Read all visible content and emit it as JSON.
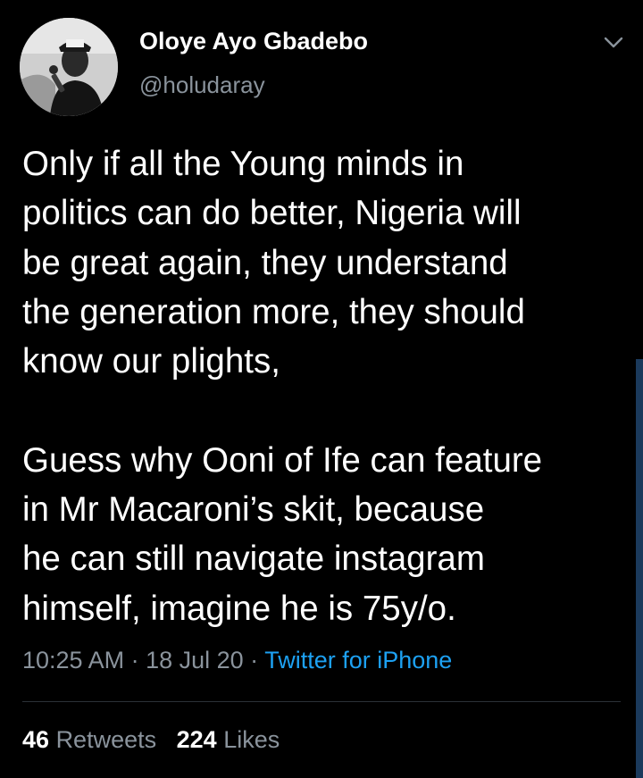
{
  "user": {
    "display_name": "Oloye Ayo Gbadebo",
    "handle": "@holudaray"
  },
  "tweet": {
    "text": "Only if all the Young minds in\npolitics can do better, Nigeria will\nbe great again, they understand\nthe generation more, they should\nknow our plights,\n\nGuess why Ooni of Ife can feature\nin Mr Macaroni’s skit, because\nhe can still navigate instagram\nhimself, imagine he is 75y/o.",
    "time": "10:25 AM",
    "date": "18 Jul 20",
    "separator": " · ",
    "source": "Twitter for iPhone"
  },
  "stats": {
    "retweets_count": "46",
    "retweets_label": "Retweets",
    "likes_count": "224",
    "likes_label": "Likes"
  },
  "icons": {
    "menu": "chevron-down-icon",
    "avatar": "profile-photo"
  },
  "colors": {
    "background": "#000000",
    "text": "#ffffff",
    "secondary_text": "#8a939c",
    "link": "#1da1f2",
    "divider": "#2b3137"
  }
}
